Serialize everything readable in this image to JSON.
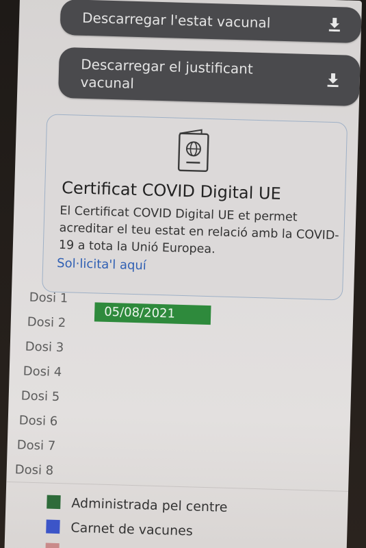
{
  "downloads": {
    "vaccination_status": "Descarregar l'estat vacunal",
    "vaccination_proof": "Descarregar el justificant vacunal"
  },
  "icons": {
    "download": "download-icon",
    "passport": "passport-icon"
  },
  "covid_card": {
    "title": "Certificat COVID Digital UE",
    "description": "El Certificat COVID Digital UE et permet acreditar el teu estat en relació amb la COVID-19 a tota la Unió Europea.",
    "link": "Sol·licita'l aquí"
  },
  "doses": [
    {
      "label": "Dosi 1",
      "date": "05/08/2021",
      "status_color": "#2e8a3c"
    },
    {
      "label": "Dosi 2"
    },
    {
      "label": "Dosi 3"
    },
    {
      "label": "Dosi 4"
    },
    {
      "label": "Dosi 5"
    },
    {
      "label": "Dosi 6"
    },
    {
      "label": "Dosi 7"
    },
    {
      "label": "Dosi 8"
    }
  ],
  "legend": [
    {
      "label": "Administrada pel centre",
      "color": "#2e6b3a"
    },
    {
      "label": "Carnet de vacunes",
      "color": "#3c55c8"
    },
    {
      "label": "",
      "color": "#c98a8a"
    }
  ]
}
